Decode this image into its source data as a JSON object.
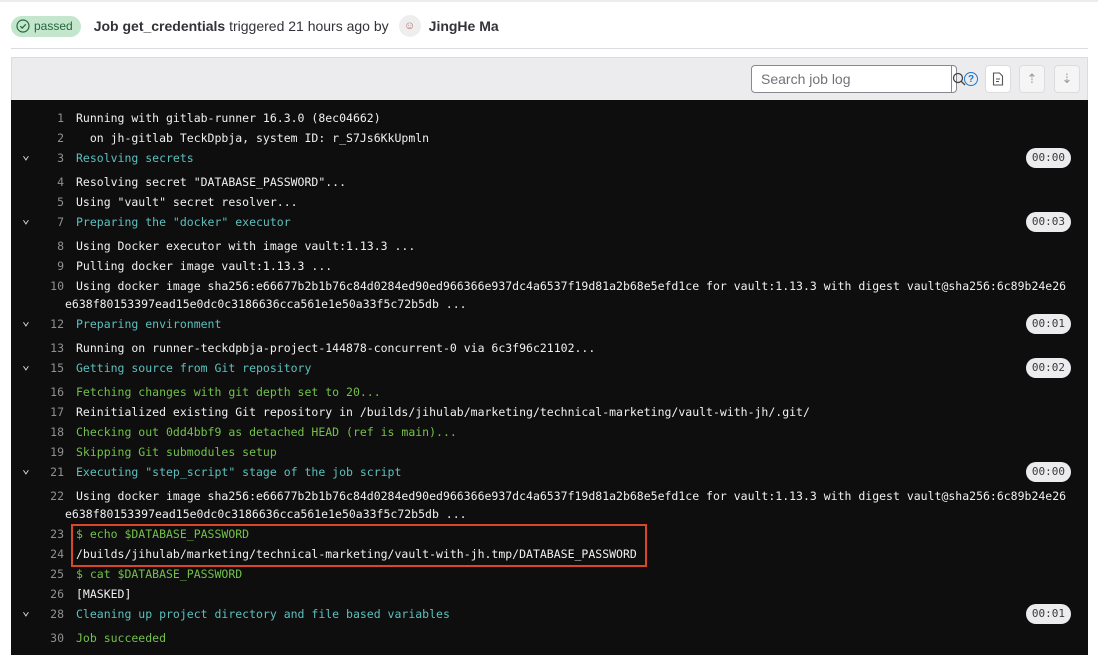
{
  "header": {
    "status": "passed",
    "job_prefix": "Job",
    "job_name": "get_credentials",
    "triggered_text": "triggered 21 hours ago by",
    "user": "JingHe Ma"
  },
  "toolbar": {
    "search_placeholder": "Search job log",
    "help": "?"
  },
  "log": [
    {
      "n": "1",
      "t": "Running with gitlab-runner 16.3.0 (8ec04662)",
      "c": ""
    },
    {
      "n": "2",
      "t": "  on jh-gitlab TeckDpbja, system ID: r_S7Js6KkUpmln",
      "c": ""
    },
    {
      "n": "3",
      "t": "Resolving secrets",
      "c": "cyan",
      "section": true,
      "time": "00:00"
    },
    {
      "n": "4",
      "t": "Resolving secret \"DATABASE_PASSWORD\"...",
      "c": ""
    },
    {
      "n": "5",
      "t": "Using \"vault\" secret resolver...",
      "c": ""
    },
    {
      "n": "7",
      "t": "Preparing the \"docker\" executor",
      "c": "cyan",
      "section": true,
      "time": "00:03"
    },
    {
      "n": "8",
      "t": "Using Docker executor with image vault:1.13.3 ...",
      "c": ""
    },
    {
      "n": "9",
      "t": "Pulling docker image vault:1.13.3 ...",
      "c": ""
    },
    {
      "n": "10",
      "t": "Using docker image sha256:e66677b2b1b76c84d0284ed90ed966366e937dc4a6537f19d81a2b68e5efd1ce for vault:1.13.3 with digest vault@sha256:6c89b24e26",
      "t2": "e638f80153397ead15e0dc0c3186636cca561e1e50a33f5c72b5db ...",
      "c": ""
    },
    {
      "n": "12",
      "t": "Preparing environment",
      "c": "cyan",
      "section": true,
      "time": "00:01"
    },
    {
      "n": "13",
      "t": "Running on runner-teckdpbja-project-144878-concurrent-0 via 6c3f96c21102...",
      "c": ""
    },
    {
      "n": "15",
      "t": "Getting source from Git repository",
      "c": "cyan",
      "section": true,
      "time": "00:02"
    },
    {
      "n": "16",
      "t": "Fetching changes with git depth set to 20...",
      "c": "green"
    },
    {
      "n": "17",
      "t": "Reinitialized existing Git repository in /builds/jihulab/marketing/technical-marketing/vault-with-jh/.git/",
      "c": ""
    },
    {
      "n": "18",
      "t": "Checking out 0dd4bbf9 as detached HEAD (ref is main)...",
      "c": "green"
    },
    {
      "n": "19",
      "t": "Skipping Git submodules setup",
      "c": "green"
    },
    {
      "n": "21",
      "t": "Executing \"step_script\" stage of the job script",
      "c": "cyan",
      "section": true,
      "time": "00:00"
    },
    {
      "n": "22",
      "t": "Using docker image sha256:e66677b2b1b76c84d0284ed90ed966366e937dc4a6537f19d81a2b68e5efd1ce for vault:1.13.3 with digest vault@sha256:6c89b24e26",
      "t2": "e638f80153397ead15e0dc0c3186636cca561e1e50a33f5c72b5db ...",
      "c": ""
    },
    {
      "n": "23",
      "t": "$ echo $DATABASE_PASSWORD",
      "c": "green"
    },
    {
      "n": "24",
      "t": "/builds/jihulab/marketing/technical-marketing/vault-with-jh.tmp/DATABASE_PASSWORD",
      "c": ""
    },
    {
      "n": "25",
      "t": "$ cat $DATABASE_PASSWORD",
      "c": "green"
    },
    {
      "n": "26",
      "t": "[MASKED]",
      "c": ""
    },
    {
      "n": "28",
      "t": "Cleaning up project directory and file based variables",
      "c": "cyan",
      "section": true,
      "time": "00:01"
    },
    {
      "n": "30",
      "t": "Job succeeded",
      "c": "green"
    }
  ]
}
